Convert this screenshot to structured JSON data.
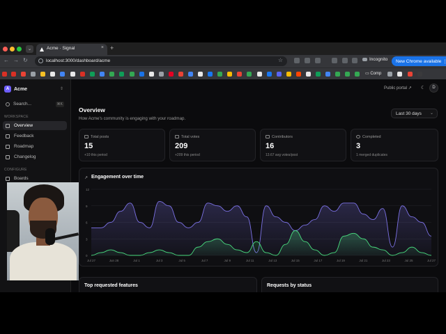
{
  "browser": {
    "tab_title": "Acme · Signal",
    "url": "localhost:3000/dashboard/acme",
    "incognito_label": "Incognito",
    "update_label": "New Chrome available",
    "bookmark_folder_label": "Comp"
  },
  "sidebar": {
    "workspace_name": "Acme",
    "workspace_initial": "A",
    "search_placeholder": "Search...",
    "search_shortcut": "⌘K",
    "section_workspace": "WORKSPACE",
    "section_configure": "CONFIGURE",
    "items": [
      {
        "label": "Overview",
        "active": true
      },
      {
        "label": "Feedback",
        "active": false
      },
      {
        "label": "Roadmap",
        "active": false
      },
      {
        "label": "Changelog",
        "active": false
      }
    ],
    "configure_items": [
      {
        "label": "Boards"
      }
    ]
  },
  "topbar": {
    "public_portal_label": "Public portal",
    "avatar_initial": "D"
  },
  "header": {
    "title": "Overview",
    "subtitle": "How Acme's community is engaging with your roadmap.",
    "range_label": "Last 30 days"
  },
  "stats": [
    {
      "label": "Total posts",
      "value": "15",
      "sub": "+10 this period"
    },
    {
      "label": "Total votes",
      "value": "209",
      "sub": "+209 this period"
    },
    {
      "label": "Contributors",
      "value": "16",
      "sub": "13.67 avg votes/post"
    },
    {
      "label": "Completed",
      "value": "3",
      "sub": "1 merged duplicates"
    }
  ],
  "panels": {
    "top_features_title": "Top requested features",
    "requests_by_status_title": "Requests by status"
  },
  "chart_data": {
    "type": "area",
    "title": "Engagement over time",
    "ylim": [
      0,
      12
    ],
    "y_ticks": [
      "12",
      "9",
      "6",
      "3",
      "0"
    ],
    "x_tick_labels": [
      "Jul 27",
      "Jun 28",
      "Jul 1",
      "Jul 3",
      "Jul 5",
      "Jul 7",
      "Jul 9",
      "Jul 11",
      "Jul 13",
      "Jul 15",
      "Jul 17",
      "Jul 19",
      "Jul 21",
      "Jul 23",
      "Jul 25",
      "Jul 27"
    ],
    "grid": true,
    "colors": {
      "votes": "#7c72e6",
      "posts": "#4ade80"
    },
    "series": [
      {
        "values": [
          5,
          5,
          6,
          8,
          9.5,
          6,
          5,
          9.8,
          9,
          6,
          5,
          6,
          9.5,
          9,
          8,
          9,
          7,
          0.5,
          9,
          7,
          6,
          4.5,
          5.5,
          6.5,
          9,
          8,
          9.5,
          9.5,
          7.5,
          6.5,
          8.5,
          1.5,
          9,
          7,
          6,
          3.5
        ]
      },
      {
        "values": [
          0,
          0.5,
          1,
          0.5,
          0,
          0,
          0.5,
          1,
          0.5,
          0,
          0,
          1.5,
          2.5,
          3,
          2,
          1,
          0.5,
          2.5,
          0.5,
          0,
          2,
          4.5,
          2.5,
          1,
          0,
          0.5,
          3.5,
          4,
          3,
          1.5,
          1,
          0,
          0.5,
          1.5,
          0.5,
          0
        ]
      }
    ]
  }
}
